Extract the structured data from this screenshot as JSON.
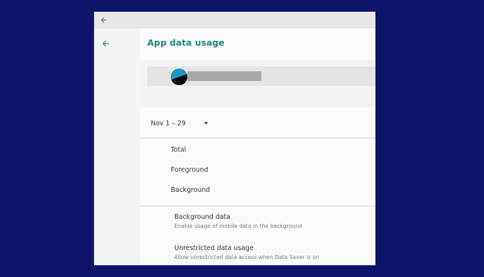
{
  "window": {
    "titlebar_back_icon": "arrow-left-icon"
  },
  "nav": {
    "back_icon": "arrow-left-icon",
    "accent_color": "#1a8a7b"
  },
  "page": {
    "title": "App data usage"
  },
  "app_header": {
    "icon": "app-icon"
  },
  "cycle": {
    "label": "Nov 1 – 29",
    "dropdown_icon": "caret-down-icon"
  },
  "stats": [
    {
      "label": "Total"
    },
    {
      "label": "Foreground"
    },
    {
      "label": "Background"
    }
  ],
  "preferences": [
    {
      "title": "Background data",
      "summary": "Enable usage of mobile data in the background"
    },
    {
      "title": "Unrestricted data usage",
      "summary": "Allow unrestricted data access when Data Saver is on"
    }
  ]
}
